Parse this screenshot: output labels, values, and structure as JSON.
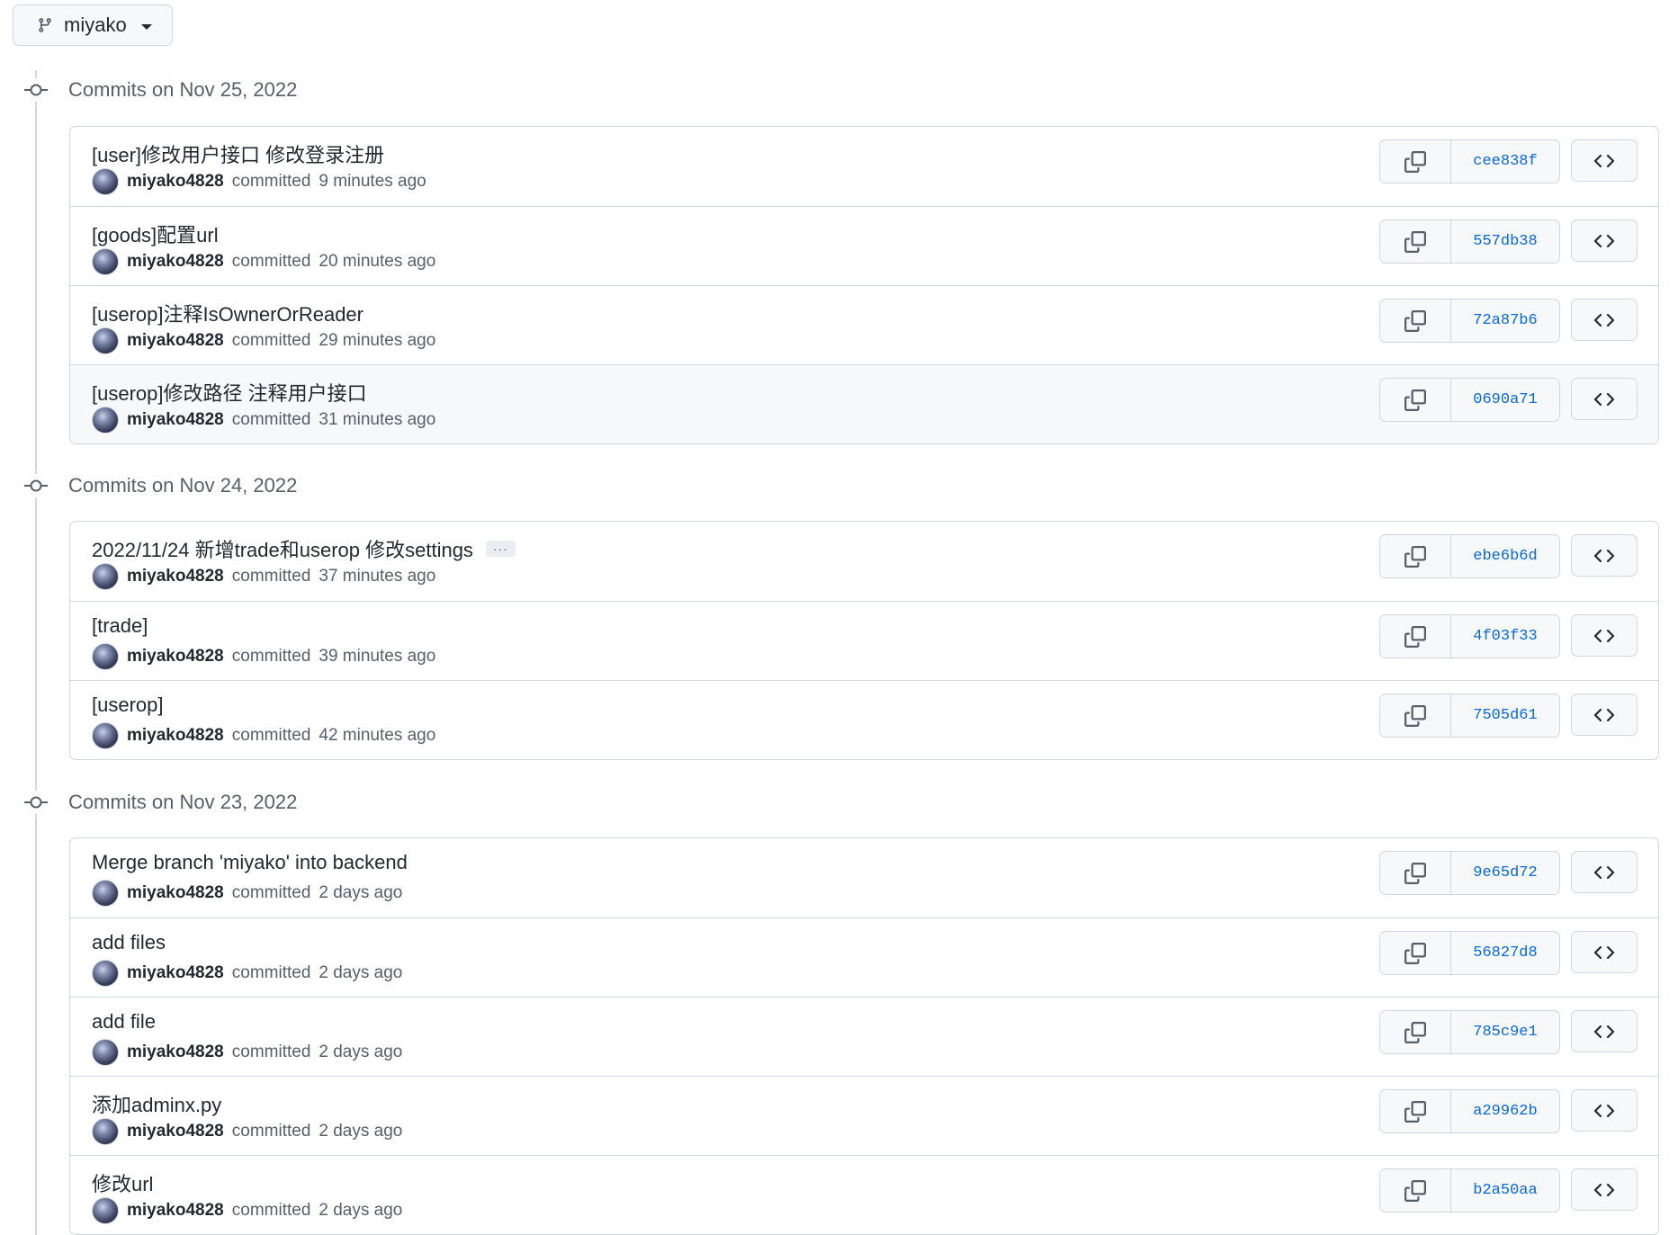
{
  "branch": {
    "name": "miyako",
    "icon": "git-branch-icon"
  },
  "groups": [
    {
      "title": "Commits on Nov 25, 2022",
      "commits": [
        {
          "message": "[user]修改用户接口 修改登录注册",
          "author": "miyako4828",
          "action": "committed",
          "time": "9 minutes ago",
          "sha": "cee838f"
        },
        {
          "message": "[goods]配置url",
          "author": "miyako4828",
          "action": "committed",
          "time": "20 minutes ago",
          "sha": "557db38"
        },
        {
          "message": "[userop]注释IsOwnerOrReader",
          "author": "miyako4828",
          "action": "committed",
          "time": "29 minutes ago",
          "sha": "72a87b6"
        },
        {
          "message": "[userop]修改路径 注释用户接口",
          "author": "miyako4828",
          "action": "committed",
          "time": "31 minutes ago",
          "sha": "0690a71"
        }
      ]
    },
    {
      "title": "Commits on Nov 24, 2022",
      "commits": [
        {
          "message": "2022/11/24 新增trade和userop 修改settings",
          "ellipsis": "···",
          "author": "miyako4828",
          "action": "committed",
          "time": "37 minutes ago",
          "sha": "ebe6b6d"
        },
        {
          "message": "[trade]",
          "author": "miyako4828",
          "action": "committed",
          "time": "39 minutes ago",
          "sha": "4f03f33"
        },
        {
          "message": "[userop]",
          "author": "miyako4828",
          "action": "committed",
          "time": "42 minutes ago",
          "sha": "7505d61"
        }
      ]
    },
    {
      "title": "Commits on Nov 23, 2022",
      "commits": [
        {
          "message": "Merge branch 'miyako' into backend",
          "author": "miyako4828",
          "action": "committed",
          "time": "2 days ago",
          "sha": "9e65d72"
        },
        {
          "message": "add files",
          "author": "miyako4828",
          "action": "committed",
          "time": "2 days ago",
          "sha": "56827d8"
        },
        {
          "message": "add file",
          "author": "miyako4828",
          "action": "committed",
          "time": "2 days ago",
          "sha": "785c9e1"
        },
        {
          "message": "添加adminx.py",
          "author": "miyako4828",
          "action": "committed",
          "time": "2 days ago",
          "sha": "a29962b"
        },
        {
          "message": "修改url",
          "author": "miyako4828",
          "action": "committed",
          "time": "2 days ago",
          "sha": "b2a50aa"
        }
      ]
    }
  ],
  "icons": {
    "commit": "git-commit-icon",
    "copy": "copy-icon",
    "browse": "code-icon"
  },
  "colors": {
    "sha_link": "#0969da",
    "muted": "#57606a",
    "border": "#d0d7de",
    "highlight_row": "#f6f8fa"
  }
}
